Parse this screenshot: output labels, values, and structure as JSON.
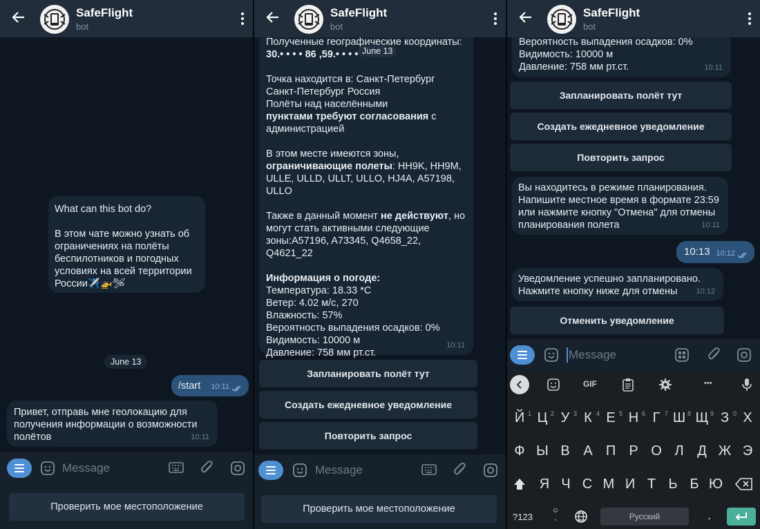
{
  "bot": {
    "name": "SafeFlight",
    "sub": "bot"
  },
  "panel1": {
    "intro_title": "What can this bot do?",
    "intro_body": "В этом чате можно узнать об ограничениях на полёты беспилотников и погодных условиях на всей территории России✈️🚁🛩",
    "date": "June 13",
    "out_text": "/start",
    "out_time": "10:11",
    "in_text": "Привет, отправь мне геолокацию для получения информации о возможности полётов",
    "in_time": "10:11",
    "placeholder": "Message",
    "reply_button": "Проверить мое местоположение"
  },
  "panel2": {
    "coords_title": "Полученные географические координаты:",
    "coords": "30.• • • •  86 ,59.• • • •",
    "date_overlay": "June 13",
    "p1": "Точка находится в: Санкт-Петербург Санкт-Петербург Россия",
    "p1b_a": "Полёты над населёнными",
    "p1b_b": "пунктами требуют согласования",
    "p1b_c": " с",
    "p1b_d": "администрацией",
    "p2a": "В этом месте имеются зоны,",
    "p2b": "ограничивающие полеты",
    "p2c": ": HH9K, HH9M, ULLE, ULLD, ULLT, ULLO, HJ4A, A57198, ULLO",
    "p3a": "Также в данный момент ",
    "p3b": "не действуют",
    "p3c": ", но могут стать активными следующие зоны",
    "p3d": ":A57196, A73345, Q4658_22, Q4621_22",
    "weather_title": "Информация о погоде:",
    "w1": "Температура: 18.33 *C",
    "w2": "Ветер: 4.02 м/с, 270",
    "w3": "Влажность: 57%",
    "w4": "Вероятность выпадения осадков: 0%",
    "w5": "Видимость: 10000 м",
    "w6": "Давление: 758 мм рт.ст.",
    "time": "10:11",
    "btn1": "Запланировать полёт тут",
    "btn2": "Создать ежедневное уведомление",
    "btn3": "Повторить запрос",
    "placeholder": "Message",
    "reply_button": "Проверить мое местоположение"
  },
  "panel3": {
    "top1": "Вероятность выпадения осадков: 0%",
    "top2": "Видимость: 10000 м",
    "top3": "Давление: 758 мм рт.ст.",
    "top_time": "10:11",
    "btn1": "Запланировать полёт тут",
    "btn2": "Создать ежедневное уведомление",
    "btn3": "Повторить запрос",
    "plan_text": "Вы находитесь в режиме планирования.\n Напишите местное время в формате 23:59 или нажмите кнопку \"Отмена\" для отмены планирования полета",
    "plan_time": "10:11",
    "out_text": "10:13",
    "out_time": "10:12",
    "sched_text": "Уведомление успешно запланировано.\nНажмите кнопку ниже для отмены",
    "sched_time": "10:12",
    "cancel_btn": "Отменить уведомление",
    "placeholder": "Message",
    "kb_gif": "GIF",
    "kb_ellipsis": "•••",
    "row1": [
      "Й",
      "Ц",
      "У",
      "К",
      "Е",
      "Н",
      "Г",
      "Ш",
      "Щ",
      "З",
      "Х"
    ],
    "row1_sup": [
      "1",
      "2",
      "3",
      "4",
      "5",
      "6",
      "7",
      "8",
      "9",
      "0",
      ""
    ],
    "row2": [
      "Ф",
      "Ы",
      "В",
      "А",
      "П",
      "Р",
      "О",
      "Л",
      "Д",
      "Ж",
      "Э"
    ],
    "row3": [
      "Я",
      "Ч",
      "С",
      "М",
      "И",
      "Т",
      "Ь",
      "Б",
      "Ю"
    ],
    "sym": "?123",
    "space": "Русский",
    "period": ".",
    "comma": ","
  }
}
